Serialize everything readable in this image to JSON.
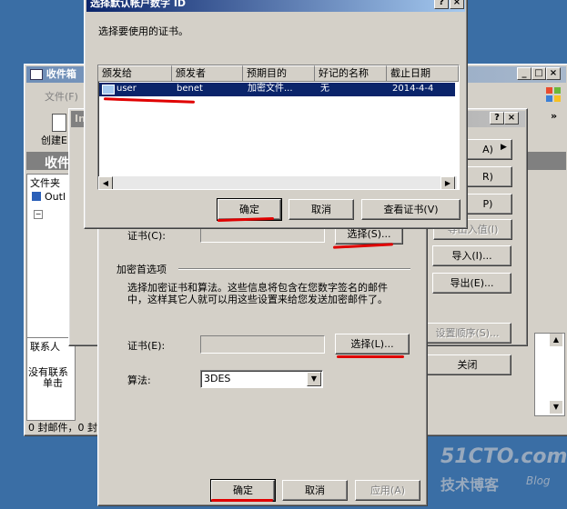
{
  "bg_window": {
    "title": "收件箱",
    "menu_file": "文件(F)",
    "toolbar_create": "创建E",
    "inbox_title": "收件",
    "folders_label": "文件夹",
    "folder_root": "Outl",
    "contacts_label": "联系人",
    "contacts_empty": "没有联系",
    "contacts_click": "单击",
    "status": "0 封邮件，0 封"
  },
  "options_dialog": {
    "title_snip": "In",
    "side_buttons": [
      "A)",
      "R)",
      "P)",
      "导出入值(I)",
      "导入(I)...",
      "导出(E)...",
      "设置顺序(S)...",
      "关闭"
    ],
    "cert_label_top": "证书(C):",
    "select_top": "选择(S)...",
    "encrypt_group": "加密首选项",
    "encrypt_desc": "选择加密证书和算法。这些信息将包含在您数字签名的邮件中，这样其它人就可以用这些设置来给您发送加密邮件了。",
    "cert_label": "证书(E):",
    "select_bottom": "选择(L)...",
    "algo_label": "算法:",
    "algo_value": "3DES",
    "ok": "确定",
    "cancel": "取消",
    "apply": "应用(A)"
  },
  "cert_dialog": {
    "title": "选择默认帐户数字 ID",
    "prompt": "选择要使用的证书。",
    "columns": [
      "颁发给",
      "颁发者",
      "预期目的",
      "好记的名称",
      "截止日期"
    ],
    "rows": [
      [
        "user",
        "benet",
        "加密文件...",
        "无",
        "2014-4-4"
      ]
    ],
    "ok": "确定",
    "cancel": "取消",
    "view_cert": "查看证书(V)"
  },
  "watermark": {
    "brand": "51CTO.com",
    "sub": "技术博客",
    "blog": "Blog"
  },
  "colors": {
    "desktop": "#3a6ea5",
    "title_active": "#0a246a",
    "selection": "#0a246a",
    "annotation": "#e00000"
  }
}
